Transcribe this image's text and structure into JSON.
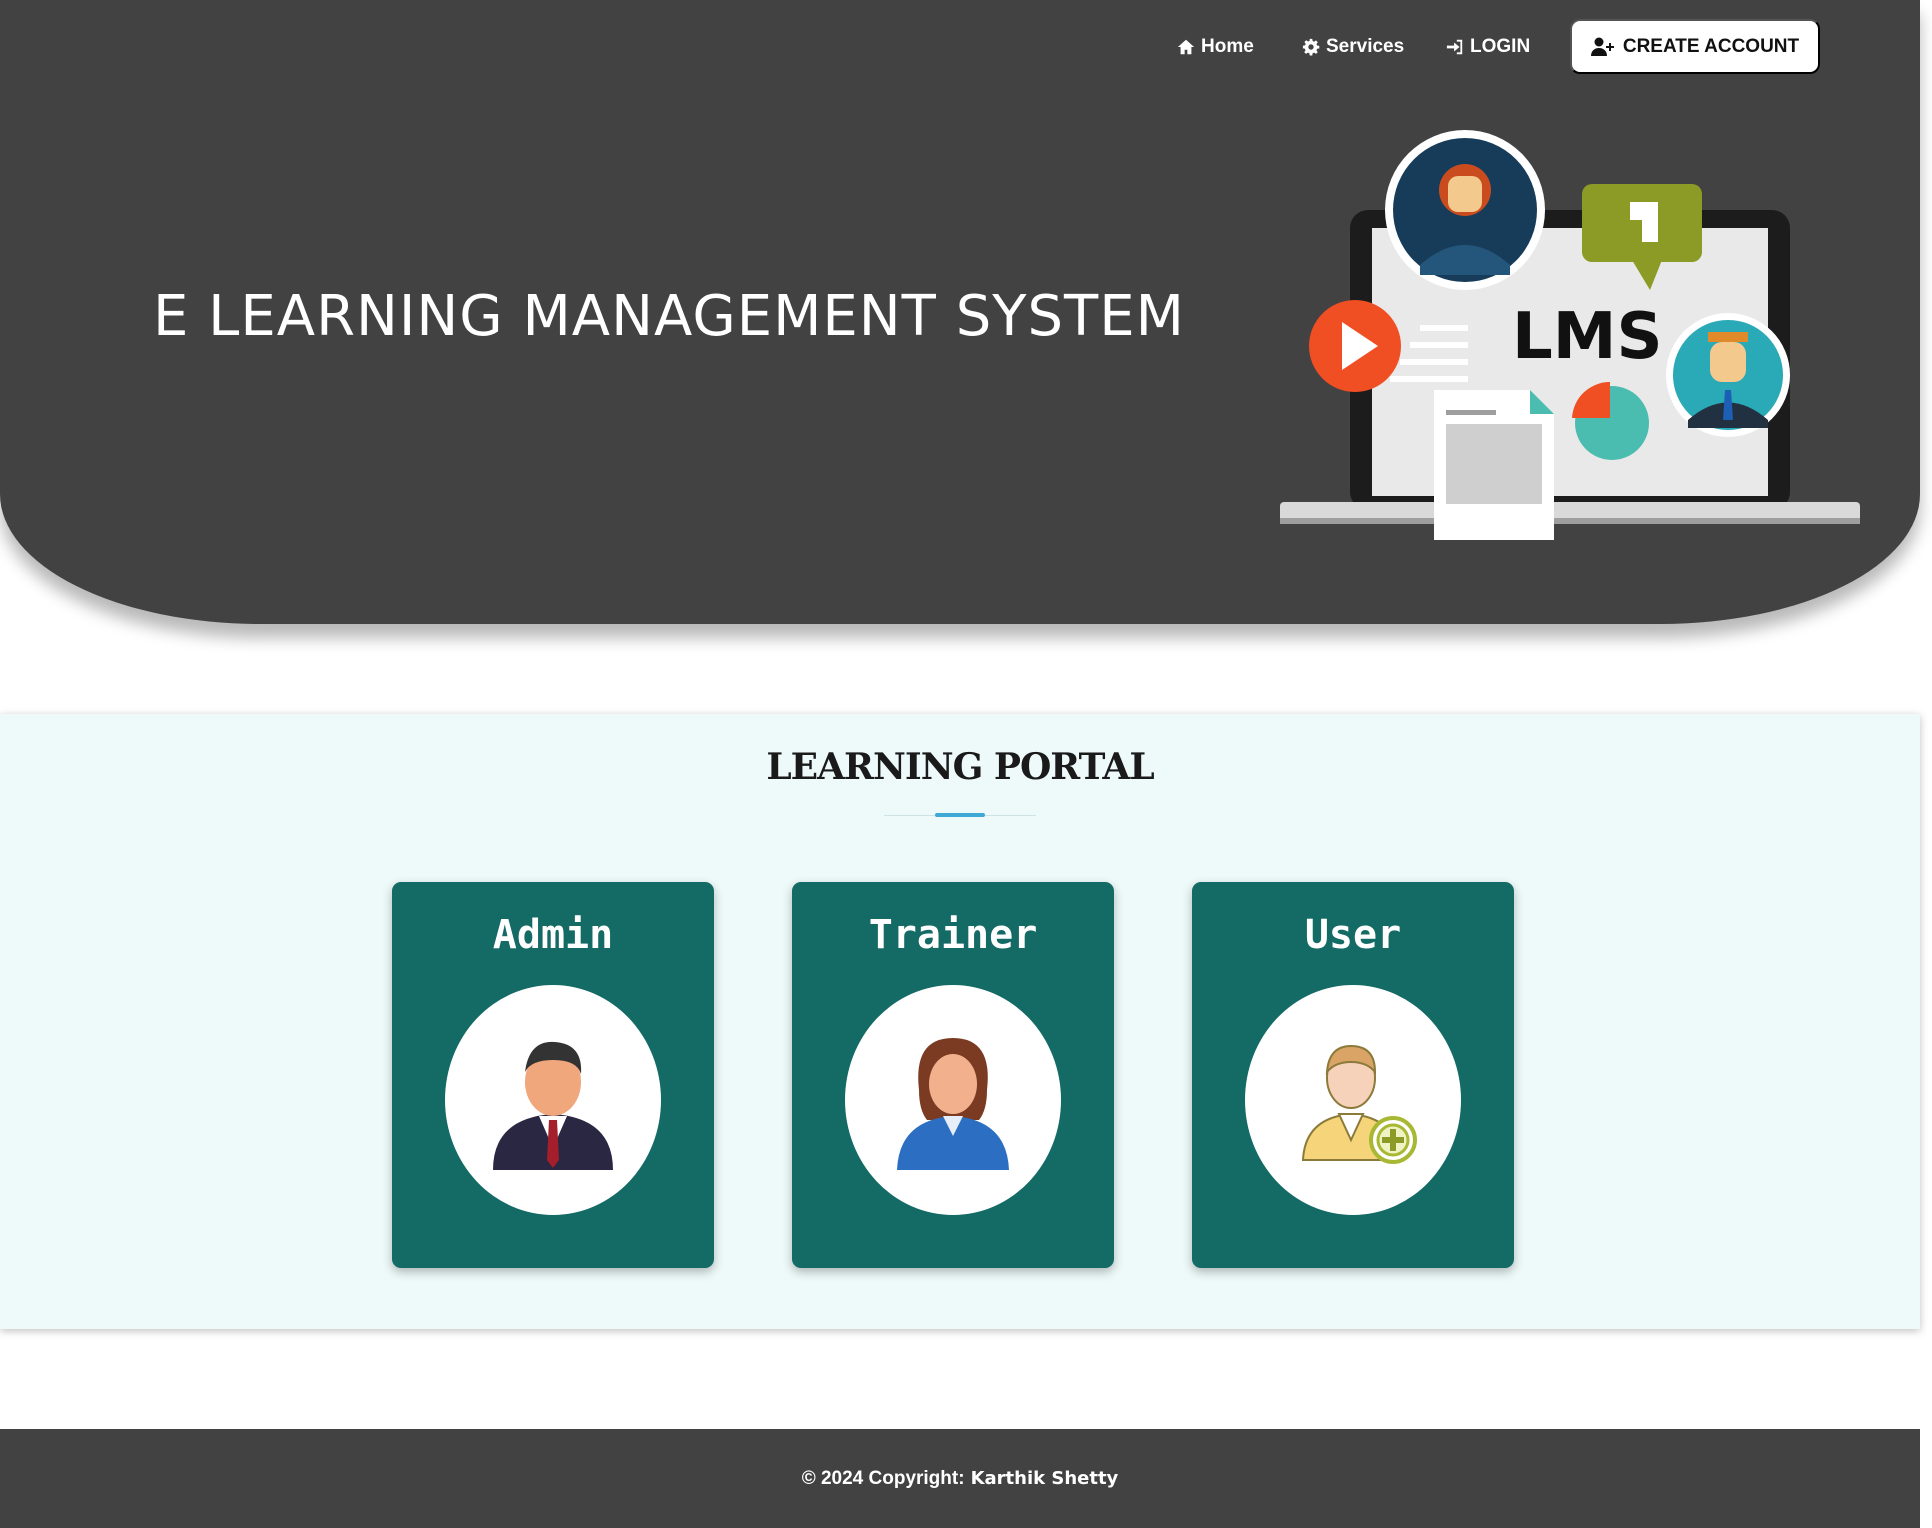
{
  "nav": {
    "home_label": "Home",
    "services_label": "Services",
    "login_label": "LOGIN",
    "create_account_label": "CREATE ACCOUNT"
  },
  "hero": {
    "title": "E LEARNING MANAGEMENT SYSTEM",
    "illustration_text": "LMS"
  },
  "portal": {
    "title": "LEARNING PORTAL",
    "cards": [
      {
        "label": "Admin",
        "icon": "businessman-icon"
      },
      {
        "label": "Trainer",
        "icon": "businesswoman-icon"
      },
      {
        "label": "User",
        "icon": "add-user-icon"
      }
    ]
  },
  "footer": {
    "copyright": "© 2024 Copyright:",
    "author": "Karthik Shetty"
  },
  "colors": {
    "header_bg": "#424242",
    "card_bg": "#146a64",
    "section_bg": "#eefafa",
    "accent": "#3fa9d6"
  }
}
